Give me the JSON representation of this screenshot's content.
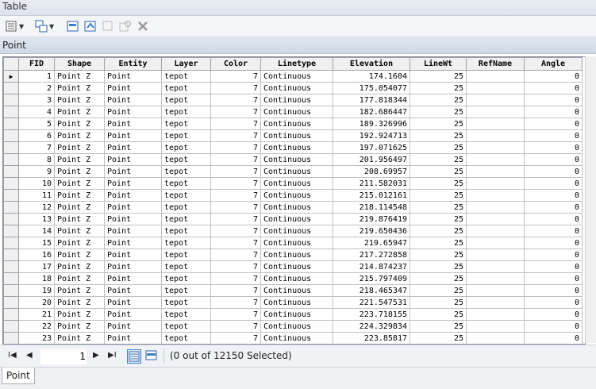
{
  "window": {
    "title": "Table"
  },
  "toolbar": {
    "icons": [
      "table-options-icon",
      "related-tables-icon",
      "select-by-attributes-icon",
      "switch-selection-icon",
      "clear-selection-icon",
      "zoom-to-selected-icon",
      "delete-selected-icon"
    ]
  },
  "table_tab": {
    "title": "Point"
  },
  "columns": [
    "FID",
    "Shape",
    "Entity",
    "Layer",
    "Color",
    "Linetype",
    "Elevation",
    "LineWt",
    "RefName",
    "Angle"
  ],
  "rows": [
    [
      "1",
      "Point Z",
      "Point",
      "tepot",
      "7",
      "Continuous",
      "174.1604",
      "25",
      "",
      "0"
    ],
    [
      "2",
      "Point Z",
      "Point",
      "tepot",
      "7",
      "Continuous",
      "175.054077",
      "25",
      "",
      "0"
    ],
    [
      "3",
      "Point Z",
      "Point",
      "tepot",
      "7",
      "Continuous",
      "177.818344",
      "25",
      "",
      "0"
    ],
    [
      "4",
      "Point Z",
      "Point",
      "tepot",
      "7",
      "Continuous",
      "182.686447",
      "25",
      "",
      "0"
    ],
    [
      "5",
      "Point Z",
      "Point",
      "tepot",
      "7",
      "Continuous",
      "189.326996",
      "25",
      "",
      "0"
    ],
    [
      "6",
      "Point Z",
      "Point",
      "tepot",
      "7",
      "Continuous",
      "192.924713",
      "25",
      "",
      "0"
    ],
    [
      "7",
      "Point Z",
      "Point",
      "tepot",
      "7",
      "Continuous",
      "197.071625",
      "25",
      "",
      "0"
    ],
    [
      "8",
      "Point Z",
      "Point",
      "tepot",
      "7",
      "Continuous",
      "201.956497",
      "25",
      "",
      "0"
    ],
    [
      "9",
      "Point Z",
      "Point",
      "tepot",
      "7",
      "Continuous",
      "208.69957",
      "25",
      "",
      "0"
    ],
    [
      "10",
      "Point Z",
      "Point",
      "tepot",
      "7",
      "Continuous",
      "211.582031",
      "25",
      "",
      "0"
    ],
    [
      "11",
      "Point Z",
      "Point",
      "tepot",
      "7",
      "Continuous",
      "215.012161",
      "25",
      "",
      "0"
    ],
    [
      "12",
      "Point Z",
      "Point",
      "tepot",
      "7",
      "Continuous",
      "218.114548",
      "25",
      "",
      "0"
    ],
    [
      "13",
      "Point Z",
      "Point",
      "tepot",
      "7",
      "Continuous",
      "219.876419",
      "25",
      "",
      "0"
    ],
    [
      "14",
      "Point Z",
      "Point",
      "tepot",
      "7",
      "Continuous",
      "219.650436",
      "25",
      "",
      "0"
    ],
    [
      "15",
      "Point Z",
      "Point",
      "tepot",
      "7",
      "Continuous",
      "219.65947",
      "25",
      "",
      "0"
    ],
    [
      "16",
      "Point Z",
      "Point",
      "tepot",
      "7",
      "Continuous",
      "217.272858",
      "25",
      "",
      "0"
    ],
    [
      "17",
      "Point Z",
      "Point",
      "tepot",
      "7",
      "Continuous",
      "214.874237",
      "25",
      "",
      "0"
    ],
    [
      "18",
      "Point Z",
      "Point",
      "tepot",
      "7",
      "Continuous",
      "215.797409",
      "25",
      "",
      "0"
    ],
    [
      "19",
      "Point Z",
      "Point",
      "tepot",
      "7",
      "Continuous",
      "218.465347",
      "25",
      "",
      "0"
    ],
    [
      "20",
      "Point Z",
      "Point",
      "tepot",
      "7",
      "Continuous",
      "221.547531",
      "25",
      "",
      "0"
    ],
    [
      "21",
      "Point Z",
      "Point",
      "tepot",
      "7",
      "Continuous",
      "223.718155",
      "25",
      "",
      "0"
    ],
    [
      "22",
      "Point Z",
      "Point",
      "tepot",
      "7",
      "Continuous",
      "224.329834",
      "25",
      "",
      "0"
    ],
    [
      "23",
      "Point Z",
      "Point",
      "tepot",
      "7",
      "Continuous",
      "223.85817",
      "25",
      "",
      "0"
    ]
  ],
  "current_row_marker": "▶",
  "navigation": {
    "first_label": "I◀",
    "prev_label": "◀",
    "current_record": "1",
    "next_label": "▶",
    "last_label": "▶I",
    "selection_status": "(0 out of 12150 Selected)"
  },
  "bottom_tabs": [
    {
      "label": "Point"
    }
  ],
  "colors": {
    "accent": "#3c7fc4",
    "header_bg": "#f0f0f0"
  }
}
